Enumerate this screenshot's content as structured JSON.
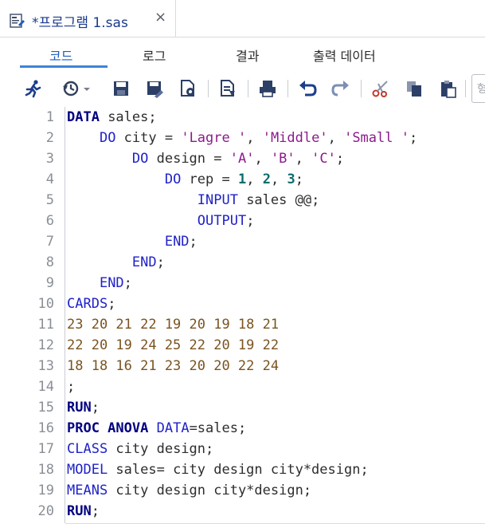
{
  "tab": {
    "title": "*프로그램 1.sas",
    "close": "×",
    "icon": "sas-program-icon"
  },
  "subtabs": [
    {
      "label": "코드",
      "active": true
    },
    {
      "label": "로그",
      "active": false
    },
    {
      "label": "결과",
      "active": false
    },
    {
      "label": "출력 데이터",
      "active": false
    }
  ],
  "toolbar": {
    "buttons": [
      "run-icon",
      "history-icon",
      "save-icon",
      "save-as-icon",
      "open-icon",
      "format-icon",
      "print-icon",
      "undo-icon",
      "redo-icon",
      "cut-icon",
      "copy-icon",
      "paste-icon"
    ],
    "search_glyph": "형"
  },
  "colors": {
    "accent": "#3d84d6",
    "keyword_bold": "#000080",
    "keyword": "#1f22c8",
    "string": "#8b1b8b",
    "number": "#0b6e6e",
    "datalines": "#7a5320"
  },
  "code": {
    "lines": [
      {
        "n": "1",
        "tokens": [
          [
            "kwb",
            "DATA"
          ],
          [
            "p",
            " sales;"
          ]
        ]
      },
      {
        "n": "2",
        "tokens": [
          [
            "p",
            "    "
          ],
          [
            "kw",
            "DO"
          ],
          [
            "p",
            " city = "
          ],
          [
            "str",
            "'Lagre '"
          ],
          [
            "p",
            ", "
          ],
          [
            "str",
            "'Middle'"
          ],
          [
            "p",
            ", "
          ],
          [
            "str",
            "'Small '"
          ],
          [
            "p",
            ";"
          ]
        ]
      },
      {
        "n": "3",
        "tokens": [
          [
            "p",
            "        "
          ],
          [
            "kw",
            "DO"
          ],
          [
            "p",
            " design = "
          ],
          [
            "str",
            "'A'"
          ],
          [
            "p",
            ", "
          ],
          [
            "str",
            "'B'"
          ],
          [
            "p",
            ", "
          ],
          [
            "str",
            "'C'"
          ],
          [
            "p",
            ";"
          ]
        ]
      },
      {
        "n": "4",
        "tokens": [
          [
            "p",
            "            "
          ],
          [
            "kw",
            "DO"
          ],
          [
            "p",
            " rep = "
          ],
          [
            "num",
            "1"
          ],
          [
            "p",
            ", "
          ],
          [
            "num",
            "2"
          ],
          [
            "p",
            ", "
          ],
          [
            "num",
            "3"
          ],
          [
            "p",
            ";"
          ]
        ]
      },
      {
        "n": "5",
        "tokens": [
          [
            "p",
            "                "
          ],
          [
            "kw",
            "INPUT"
          ],
          [
            "p",
            " sales @@;"
          ]
        ]
      },
      {
        "n": "6",
        "tokens": [
          [
            "p",
            "                "
          ],
          [
            "kw",
            "OUTPUT"
          ],
          [
            "p",
            ";"
          ]
        ]
      },
      {
        "n": "7",
        "tokens": [
          [
            "p",
            "            "
          ],
          [
            "kw",
            "END"
          ],
          [
            "p",
            ";"
          ]
        ]
      },
      {
        "n": "8",
        "tokens": [
          [
            "p",
            "        "
          ],
          [
            "kw",
            "END"
          ],
          [
            "p",
            ";"
          ]
        ]
      },
      {
        "n": "9",
        "tokens": [
          [
            "p",
            "    "
          ],
          [
            "kw",
            "END"
          ],
          [
            "p",
            ";"
          ]
        ]
      },
      {
        "n": "10",
        "tokens": [
          [
            "kw",
            "CARDS"
          ],
          [
            "p",
            ";"
          ]
        ]
      },
      {
        "n": "11",
        "tokens": [
          [
            "dl",
            "23 20 21 22 19 20 19 18 21"
          ]
        ]
      },
      {
        "n": "12",
        "tokens": [
          [
            "dl",
            "22 20 19 24 25 22 20 19 22"
          ]
        ]
      },
      {
        "n": "13",
        "tokens": [
          [
            "dl",
            "18 18 16 21 23 20 20 22 24"
          ]
        ]
      },
      {
        "n": "14",
        "tokens": [
          [
            "p",
            ";"
          ]
        ]
      },
      {
        "n": "15",
        "tokens": [
          [
            "kwb",
            "RUN"
          ],
          [
            "p",
            ";"
          ]
        ]
      },
      {
        "n": "16",
        "tokens": [
          [
            "kwb",
            "PROC ANOVA"
          ],
          [
            "p",
            " "
          ],
          [
            "kw",
            "DATA"
          ],
          [
            "p",
            "=sales;"
          ]
        ]
      },
      {
        "n": "17",
        "tokens": [
          [
            "kw",
            "CLASS"
          ],
          [
            "p",
            " city design;"
          ]
        ]
      },
      {
        "n": "18",
        "tokens": [
          [
            "kw",
            "MODEL"
          ],
          [
            "p",
            " sales= city design city*design;"
          ]
        ]
      },
      {
        "n": "19",
        "tokens": [
          [
            "kw",
            "MEANS"
          ],
          [
            "p",
            " city design city*design;"
          ]
        ]
      },
      {
        "n": "20",
        "tokens": [
          [
            "kwb",
            "RUN"
          ],
          [
            "p",
            ";"
          ]
        ]
      }
    ]
  }
}
